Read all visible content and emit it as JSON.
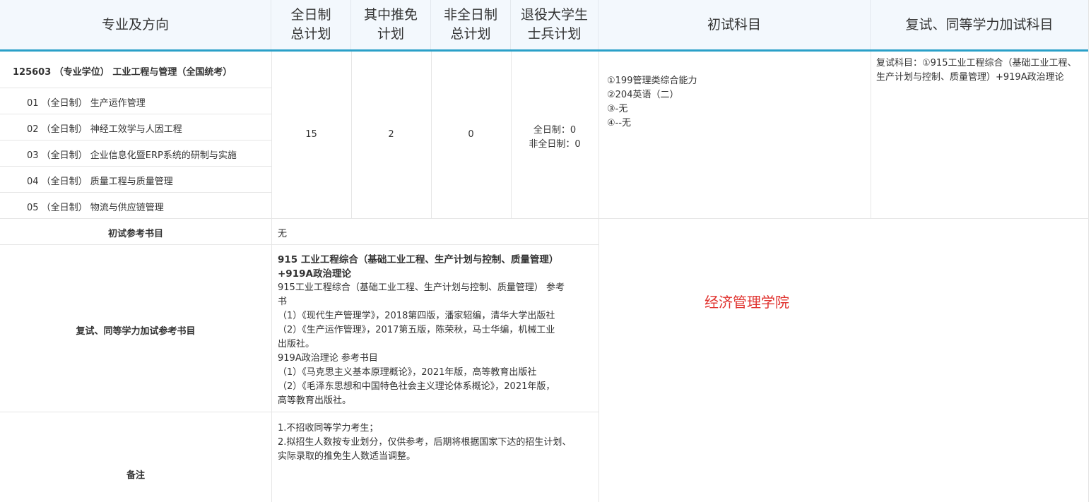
{
  "header": {
    "major": "专业及方向",
    "fulltime_plan": [
      "全日制",
      "总计划"
    ],
    "recommended_plan": [
      "其中推免",
      "计划"
    ],
    "parttime_plan": [
      "非全日制",
      "总计划"
    ],
    "veteran_plan": [
      "退役大学生",
      "士兵计划"
    ],
    "initial_subjects": "初试科目",
    "retest_subjects": "复试、同等学力加试科目"
  },
  "program": {
    "title": "125603 （专业学位） 工业工程与管理（全国统考）",
    "directions": [
      "01 （全日制） 生产运作管理",
      "02 （全日制） 神经工效学与人因工程",
      "03 （全日制） 企业信息化暨ERP系统的研制与实施",
      "04 （全日制） 质量工程与质量管理",
      "05 （全日制） 物流与供应链管理"
    ],
    "fulltime_plan": "15",
    "recommended_plan": "2",
    "parttime_plan": "0",
    "veteran_plan": [
      "全日制：0",
      "非全日制：0"
    ],
    "initial_subjects": [
      "①199管理类综合能力",
      "②204英语（二）",
      "③-无",
      "④--无"
    ],
    "retest_subjects": "复试科目：①915工业工程综合（基础工业工程、生产计划与控制、质量管理）+919A政治理论"
  },
  "refs": {
    "initial_label": "初试参考书目",
    "initial_value": "无",
    "retest_label": "复试、同等学力加试参考书目",
    "retest_title": [
      "915 工业工程综合（基础工业工程、生产计划与控制、质量管理）",
      "+919A政治理论"
    ],
    "retest_lines": [
      "915工业工程综合（基础工业工程、生产计划与控制、质量管理） 参考",
      "书",
      "（1）《现代生产管理学》，2018第四版，潘家轺编，清华大学出版社",
      "（2）《生产运作管理》，2017第五版，陈荣秋，马士华编，机械工业",
      "出版社。",
      "919A政治理论 参考书目",
      "（1）《马克思主义基本原理概论》，2021年版，高等教育出版社",
      "（2）《毛泽东思想和中国特色社会主义理论体系概论》，2021年版，",
      "高等教育出版社。"
    ],
    "notes_label": "备注",
    "notes_lines": [
      "1.不招收同等学力考生；",
      "2.拟招生人数按专业划分，仅供参考，后期将根据国家下达的招生计划、",
      "实际录取的推免生人数适当调整。"
    ]
  },
  "college": "经济管理学院"
}
